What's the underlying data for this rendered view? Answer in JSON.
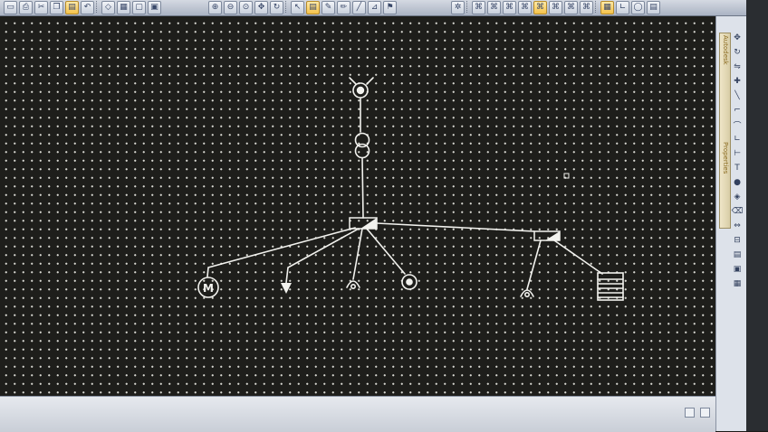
{
  "toolbar": {
    "icons": [
      "save-icon",
      "print-icon",
      "cut-icon",
      "copy-icon",
      "paste-icon",
      "undo-icon",
      "zoom-in-icon",
      "zoom-out-icon",
      "zoom-fit-icon",
      "pan-icon",
      "select-icon",
      "line-icon",
      "symbol-icon",
      "text-icon",
      "layer-icon",
      "snap-icon",
      "grid-icon"
    ]
  },
  "right_panel": {
    "tab_labels": [
      "Autodesk",
      "Properties"
    ],
    "icons": [
      "move-icon",
      "rotate-icon",
      "mirror-icon",
      "line-icon",
      "polyline-icon",
      "arc-icon",
      "circle-icon",
      "text-icon",
      "dimension-icon",
      "hatch-icon",
      "node-icon",
      "erase-icon"
    ]
  },
  "canvas": {
    "background": "#1e1e1b",
    "line_color": "#f2f2ee"
  },
  "diagram": {
    "components": [
      "grid-supply-symbol",
      "transformer-symbol",
      "main-busbar",
      "sub-busbar",
      "motor-load",
      "arrow-load",
      "socket-outlet",
      "lamp-symbol",
      "socket-outlet-right",
      "distribution-board"
    ],
    "motor_label": "M"
  }
}
